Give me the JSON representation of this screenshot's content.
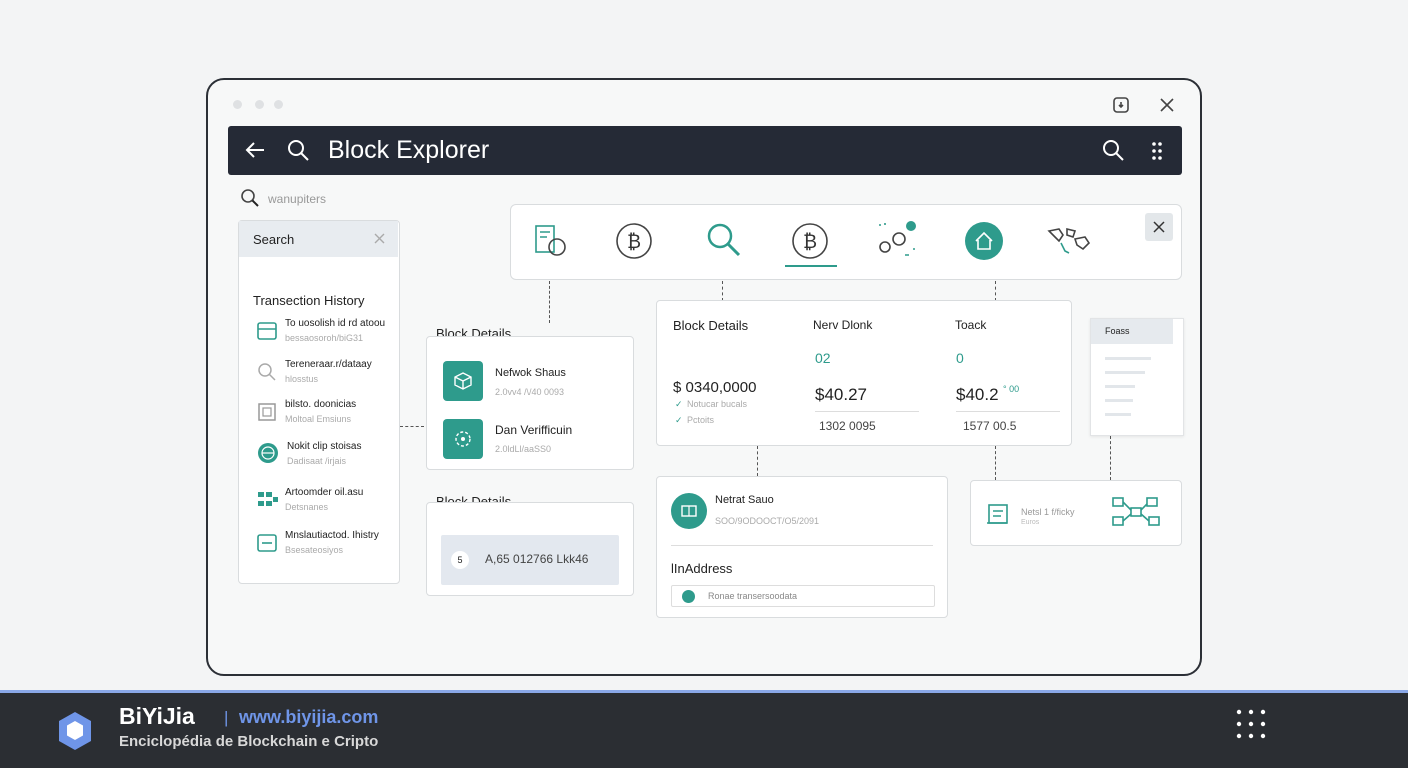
{
  "titlebar": {
    "title": "Block Explorer"
  },
  "search_top": {
    "placeholder": "wanupiters"
  },
  "sidebar": {
    "search_label": "Search",
    "section_title": "Transection History",
    "items": [
      {
        "title": "To uosolish id rd atoou",
        "subtitle": "bessaosoroh/biG31"
      },
      {
        "title": "Tereneraar.r/dataay",
        "subtitle": "hlosstus"
      },
      {
        "title": "bilsto. doonicias",
        "subtitle": "Moltoal Emsiuns"
      },
      {
        "title": "Nokit clip stoisas",
        "subtitle": "Dadisaat /irjais"
      },
      {
        "title": "Artoomder oil.asu",
        "subtitle": "Detsnanes"
      },
      {
        "title": "Mnslautiactod. Ihistry",
        "subtitle": "Bsesateosiyos"
      }
    ]
  },
  "block_details_1": {
    "heading": "Block Details",
    "rows": [
      {
        "title": "Nefwok Shaus",
        "sub": "2.0vv4 /\\/40 0093"
      },
      {
        "title": "Dan Verifficuin",
        "sub": "2.0ldLl/aaSS0"
      }
    ]
  },
  "block_details_2": {
    "heading": "Block Details",
    "value": "A,65 012766 Lkk46",
    "badge": "5"
  },
  "details_main": {
    "heading": "Block Details",
    "col2": "Nerv Dlonk",
    "col3": "Toack",
    "num2": "02",
    "num3": "0",
    "amount1": "$ 0340,0000",
    "amount2": "$40.27",
    "amount3": "$40.2",
    "amount3_suffix": "° 00",
    "sub1a": "Notucar bucals",
    "sub1b": "Pctoits",
    "val2": "1302 0095",
    "val3": "1577 00.5"
  },
  "network_card": {
    "title": "Netrat Sauo",
    "sub": "SOO/9ODOOCT/O5/2091",
    "address_label": "lInAddress",
    "field_text": "Ronae transersoodata"
  },
  "right_panel": {
    "title": "Foass"
  },
  "net_fee": {
    "title": "Netsl 1 f/ficky",
    "sub": "Euros"
  },
  "footer": {
    "brand": "BiYiJia",
    "separator": "|",
    "url": "www.biyijia.com",
    "tagline": "Enciclopédia de Blockchain e Cripto"
  }
}
